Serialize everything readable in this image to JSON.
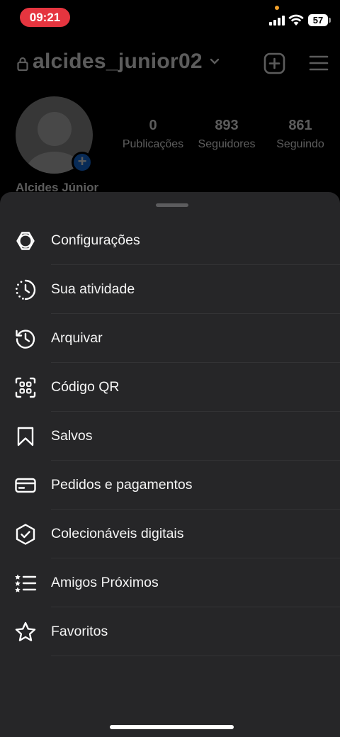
{
  "status_bar": {
    "time": "09:21",
    "battery": "57",
    "accent_color": "#e5353f"
  },
  "profile": {
    "username": "alcides_junior02",
    "display_name": "Alcides Júnior",
    "stats": [
      {
        "value": "0",
        "label": "Publicações"
      },
      {
        "value": "893",
        "label": "Seguidores"
      },
      {
        "value": "861",
        "label": "Seguindo"
      }
    ]
  },
  "menu": {
    "items": [
      {
        "label": "Configurações",
        "icon": "settings-gear-icon"
      },
      {
        "label": "Sua atividade",
        "icon": "activity-clock-icon"
      },
      {
        "label": "Arquivar",
        "icon": "archive-history-icon"
      },
      {
        "label": "Código QR",
        "icon": "qr-code-icon"
      },
      {
        "label": "Salvos",
        "icon": "bookmark-icon"
      },
      {
        "label": "Pedidos e pagamentos",
        "icon": "credit-card-icon"
      },
      {
        "label": "Colecionáveis digitais",
        "icon": "verified-shield-icon"
      },
      {
        "label": "Amigos Próximos",
        "icon": "close-friends-list-icon"
      },
      {
        "label": "Favoritos",
        "icon": "star-icon"
      }
    ]
  }
}
